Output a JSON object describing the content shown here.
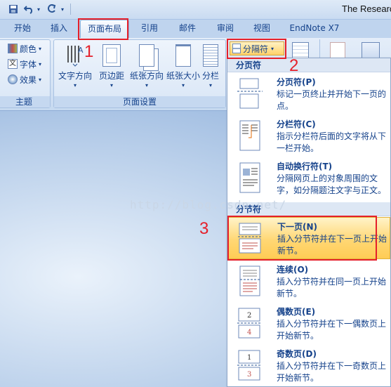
{
  "window": {
    "title": "The Research"
  },
  "qat": {
    "undo_icon": "undo-icon",
    "redo_icon": "redo-icon",
    "save_icon": "save-icon"
  },
  "tabs": [
    {
      "label": "开始"
    },
    {
      "label": "插入"
    },
    {
      "label": "页面布局"
    },
    {
      "label": "引用"
    },
    {
      "label": "邮件"
    },
    {
      "label": "审阅"
    },
    {
      "label": "视图"
    },
    {
      "label": "EndNote X7"
    }
  ],
  "ribbon": {
    "theme": {
      "colors": "颜色",
      "fonts": "字体",
      "effects": "效果",
      "group_label": "主题"
    },
    "page_setup": {
      "buttons": [
        {
          "label": "文字方向"
        },
        {
          "label": "页边距"
        },
        {
          "label": "纸张方向"
        },
        {
          "label": "纸张大小"
        },
        {
          "label": "分栏"
        }
      ],
      "group_label": "页面设置"
    },
    "breaks": {
      "label": "分隔符"
    }
  },
  "annotations": {
    "step1": "1",
    "step2": "2",
    "step3": "3"
  },
  "watermark": "http://blog.csdn.net/",
  "dropdown": {
    "page_breaks_header": "分页符",
    "section_breaks_header": "分节符",
    "page_breaks": [
      {
        "title": "分页符(P)",
        "desc": "标记一页终止并开始下一页的点。"
      },
      {
        "title": "分栏符(C)",
        "desc": "指示分栏符后面的文字将从下一栏开始。"
      },
      {
        "title": "自动换行符(T)",
        "desc": "分隔网页上的对象周围的文字，如分隔题注文字与正文。"
      }
    ],
    "section_breaks": [
      {
        "title": "下一页(N)",
        "desc": "插入分节符并在下一页上开始新节。"
      },
      {
        "title": "连续(O)",
        "desc": "插入分节符并在同一页上开始新节。"
      },
      {
        "title": "偶数页(E)",
        "desc": "插入分节符并在下一偶数页上开始新节。"
      },
      {
        "title": "奇数页(D)",
        "desc": "插入分节符并在下一奇数页上开始新节。"
      }
    ]
  },
  "colors": {
    "accent_red": "#e5202b",
    "highlight": "#ffd774",
    "ribbon_text": "#15428b"
  }
}
